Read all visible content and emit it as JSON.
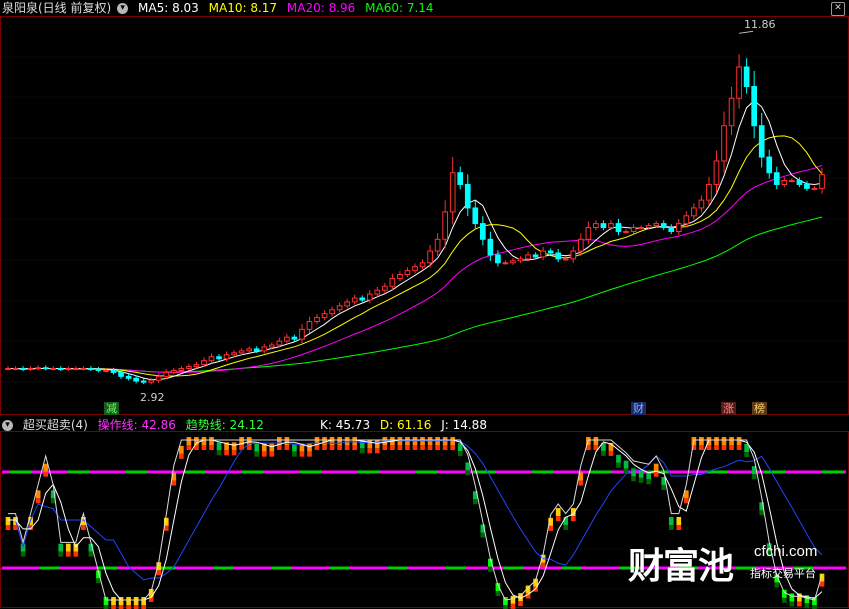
{
  "header": {
    "stock": "泉阳泉(日线 前复权)",
    "ma5": "MA5: 8.03",
    "ma10": "MA10: 8.17",
    "ma20": "MA20: 8.96",
    "ma60": "MA60: 7.14"
  },
  "sub_header": {
    "indicator": "超买超卖(4)",
    "op_line": "操作线: 42.86",
    "trend_line": "趋势线: 24.12",
    "k": "K: 45.73",
    "d": "D: 61.16",
    "j": "J: 14.88"
  },
  "annotations": {
    "high": "11.86",
    "low": "2.92",
    "sig1": "减",
    "sig2": "财",
    "sig3": "涨",
    "sig4": "榜"
  },
  "watermark": {
    "brand": "财富池",
    "url": "cfchi.com",
    "slogan": "指标交易平台"
  },
  "colors": {
    "ma5": "#ffffff",
    "ma10": "#ffff00",
    "ma20": "#ff00ff",
    "ma60": "#00ff00",
    "up": "#ff3030",
    "down": "#00ffff",
    "k": "#ffffff",
    "d": "#ffff00",
    "j": "#ff00ff"
  },
  "chart_data": {
    "type": "candlestick",
    "high_label": 11.86,
    "low_label": 2.92,
    "closes": [
      3.3,
      3.3,
      3.28,
      3.3,
      3.32,
      3.3,
      3.3,
      3.28,
      3.3,
      3.3,
      3.3,
      3.28,
      3.25,
      3.25,
      3.2,
      3.1,
      3.05,
      2.98,
      2.95,
      3.0,
      3.1,
      3.2,
      3.25,
      3.3,
      3.35,
      3.4,
      3.5,
      3.6,
      3.55,
      3.65,
      3.7,
      3.75,
      3.8,
      3.75,
      3.85,
      3.9,
      4.0,
      4.1,
      4.05,
      4.3,
      4.5,
      4.6,
      4.7,
      4.8,
      4.9,
      5.0,
      5.1,
      5.05,
      5.2,
      5.3,
      5.4,
      5.6,
      5.7,
      5.8,
      5.9,
      6.0,
      6.3,
      6.6,
      7.3,
      8.3,
      8.0,
      7.4,
      7.0,
      6.6,
      6.2,
      6.0,
      6.0,
      6.05,
      6.1,
      6.2,
      6.15,
      6.3,
      6.25,
      6.1,
      6.1,
      6.3,
      6.6,
      6.9,
      7.0,
      6.9,
      7.0,
      6.8,
      6.8,
      6.9,
      6.9,
      6.95,
      7.0,
      6.9,
      6.8,
      7.0,
      7.2,
      7.4,
      7.6,
      8.0,
      8.6,
      9.5,
      10.2,
      11.0,
      10.5,
      9.5,
      8.7,
      8.3,
      8.0,
      8.1,
      8.1,
      8.0,
      7.9,
      7.9,
      8.25
    ],
    "ma60_end": 7.14,
    "indicator": {
      "name": "超买超卖(4)",
      "op_line": 42.86,
      "trend_line": 24.12,
      "k": 45.73,
      "d": 61.16,
      "j": 14.88,
      "upper_level": 80,
      "lower_level": 20
    }
  }
}
